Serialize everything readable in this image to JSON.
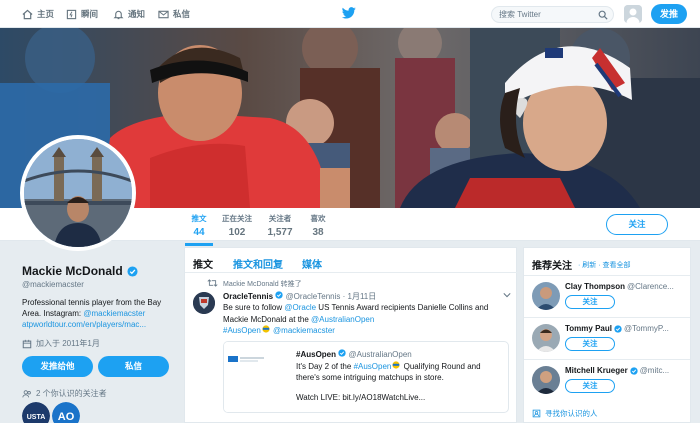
{
  "topbar": {
    "nav": [
      {
        "label": "主页",
        "icon": "home-icon"
      },
      {
        "label": "瞬间",
        "icon": "lightning-icon"
      },
      {
        "label": "通知",
        "icon": "bell-icon"
      },
      {
        "label": "私信",
        "icon": "mail-icon"
      }
    ],
    "search_placeholder": "搜索 Twitter",
    "tweet_button": "发推"
  },
  "profile_nav": {
    "stats": [
      {
        "label": "推文",
        "value": "44"
      },
      {
        "label": "正在关注",
        "value": "102"
      },
      {
        "label": "关注者",
        "value": "1,577"
      },
      {
        "label": "喜欢",
        "value": "38"
      }
    ],
    "follow_button": "关注"
  },
  "profile": {
    "name": "Mackie McDonald",
    "handle": "@mackiemacster",
    "bio_line1": "Professional tennis player from the Bay",
    "bio_line2_prefix": "Area. Instagram: ",
    "bio_instagram": "@mackiemacster",
    "bio_url": "atpworldtour.com/en/players/mac...",
    "joined": "加入于 2011年1月",
    "tweet_to_button": "发推给他",
    "message_button": "私信",
    "mutual_followers": "2 个你认识的关注者",
    "mutual_avatar_labels": [
      "USTA",
      "AO"
    ]
  },
  "timeline": {
    "tabs": [
      "推文",
      "推文和回复",
      "媒体"
    ],
    "retweet_label": "Mackie McDonald 转推了",
    "tweet": {
      "author": "OracleTennis",
      "handle": "@OracleTennis",
      "date": "· 1月11日",
      "text_1": "Be sure to follow ",
      "mention_oracle": "@Oracle",
      "text_2": " US Tennis Award recipients Danielle Collins and Mackie McDonald at the ",
      "mention_ao": "@AustralianOpen",
      "hashtag": "#AusOpen",
      "mention_mackie": "@mackiemacster"
    },
    "quote": {
      "hashtag_title": "#AusOpen",
      "handle": "@AustralianOpen",
      "text_1": "It's Day 2 of the ",
      "hashtag": "#AusOpen",
      "text_2": " Qualifying Round and there's some intriguing matchups in store.",
      "link": "Watch LIVE: bit.ly/AO18WatchLive..."
    }
  },
  "who_to_follow": {
    "title": "推荐关注",
    "links": "· 刷新 · 查看全部",
    "items": [
      {
        "name": "Clay Thompson",
        "handle": "@Clarence...",
        "button": "关注"
      },
      {
        "name": "Tommy Paul",
        "handle": "@TommyP...",
        "button": "关注"
      },
      {
        "name": "Mitchell Krueger",
        "handle": "@mitc...",
        "button": "关注"
      }
    ],
    "find_people": "寻找你认识的人"
  },
  "colors": {
    "accent": "#1da1f2",
    "link": "#1b95e0",
    "muted": "#657786"
  }
}
